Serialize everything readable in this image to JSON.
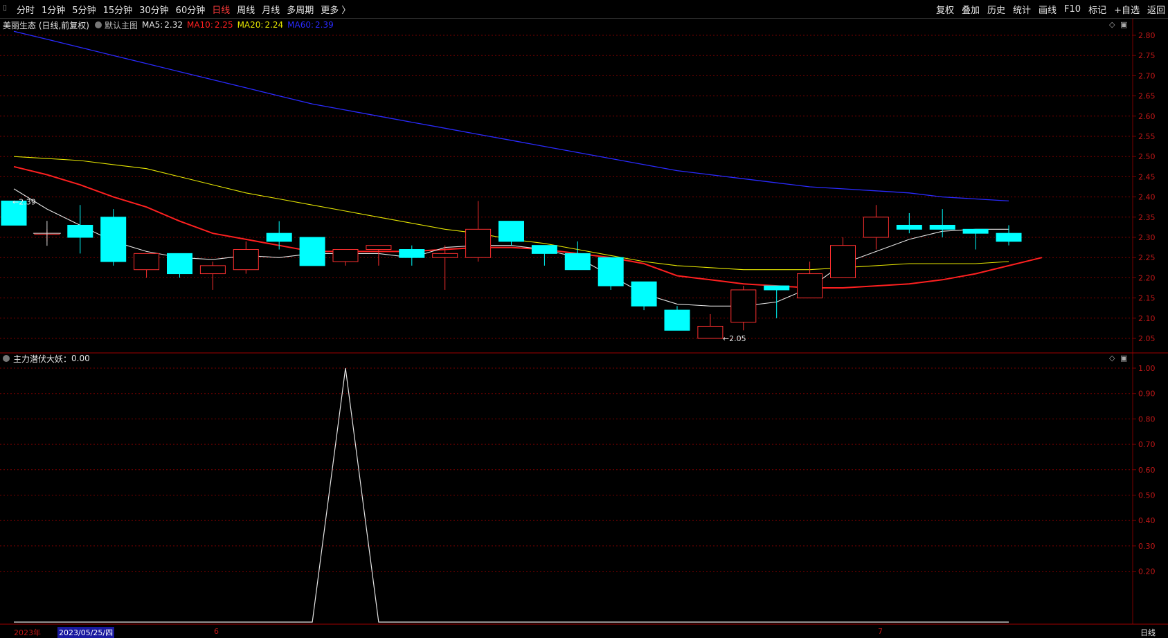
{
  "toolbar": {
    "periods": [
      "分时",
      "1分钟",
      "5分钟",
      "15分钟",
      "30分钟",
      "60分钟",
      "日线",
      "周线",
      "月线",
      "多周期",
      "更多 〉"
    ],
    "active_period": "日线",
    "tools": [
      "复权",
      "叠加",
      "历史",
      "统计",
      "画线",
      "F10",
      "标记",
      "+自选",
      "返回"
    ]
  },
  "main_legend": {
    "stock": "美丽生态 (日线,前复权)",
    "template": "默认主图",
    "ma": [
      {
        "label": "MA5:",
        "value": "2.32",
        "color": "#e6e6e6"
      },
      {
        "label": "MA10:",
        "value": "2.25",
        "color": "#ff2020"
      },
      {
        "label": "MA20:",
        "value": "2.24",
        "color": "#e6e600"
      },
      {
        "label": "MA60:",
        "value": "2.39",
        "color": "#2a2aff"
      }
    ]
  },
  "sub_legend": {
    "name": "主力潜伏大妖",
    "value": "0.00"
  },
  "annotations": {
    "high": "2.39",
    "low": "2.05"
  },
  "bottom": {
    "year": "2023年",
    "date": "2023/05/25/四",
    "m6": "6",
    "m7": "7",
    "period": "日线"
  },
  "colors": {
    "up": "#ff3030",
    "down": "#00ffff",
    "ma5": "#e6e6e6",
    "ma10": "#ff2020",
    "ma20": "#e6e600",
    "ma60": "#2a2aff",
    "grid": "#7a0000"
  },
  "chart_data": [
    {
      "type": "candlestick",
      "ylim": [
        2.05,
        2.8
      ],
      "yticks": [
        "2.80",
        "2.75",
        "2.70",
        "2.65",
        "2.60",
        "2.55",
        "2.50",
        "2.45",
        "2.40",
        "2.35",
        "2.30",
        "2.25",
        "2.20",
        "2.15",
        "2.10",
        "2.05"
      ],
      "candles": [
        {
          "o": 2.39,
          "h": 2.39,
          "l": 2.33,
          "c": 2.33
        },
        {
          "o": 2.31,
          "h": 2.32,
          "l": 2.29,
          "c": 2.31
        },
        {
          "o": 2.33,
          "h": 2.38,
          "l": 2.26,
          "c": 2.3
        },
        {
          "o": 2.35,
          "h": 2.37,
          "l": 2.23,
          "c": 2.24
        },
        {
          "o": 2.22,
          "h": 2.26,
          "l": 2.2,
          "c": 2.26
        },
        {
          "o": 2.26,
          "h": 2.26,
          "l": 2.2,
          "c": 2.21
        },
        {
          "o": 2.21,
          "h": 2.24,
          "l": 2.17,
          "c": 2.23
        },
        {
          "o": 2.22,
          "h": 2.29,
          "l": 2.21,
          "c": 2.27
        },
        {
          "o": 2.31,
          "h": 2.34,
          "l": 2.27,
          "c": 2.29
        },
        {
          "o": 2.3,
          "h": 2.3,
          "l": 2.23,
          "c": 2.23
        },
        {
          "o": 2.24,
          "h": 2.27,
          "l": 2.23,
          "c": 2.27
        },
        {
          "o": 2.27,
          "h": 2.28,
          "l": 2.23,
          "c": 2.28
        },
        {
          "o": 2.27,
          "h": 2.28,
          "l": 2.23,
          "c": 2.25
        },
        {
          "o": 2.25,
          "h": 2.28,
          "l": 2.17,
          "c": 2.26
        },
        {
          "o": 2.25,
          "h": 2.39,
          "l": 2.24,
          "c": 2.32
        },
        {
          "o": 2.34,
          "h": 2.34,
          "l": 2.28,
          "c": 2.29
        },
        {
          "o": 2.28,
          "h": 2.28,
          "l": 2.23,
          "c": 2.26
        },
        {
          "o": 2.26,
          "h": 2.29,
          "l": 2.22,
          "c": 2.22
        },
        {
          "o": 2.25,
          "h": 2.25,
          "l": 2.17,
          "c": 2.18
        },
        {
          "o": 2.19,
          "h": 2.19,
          "l": 2.12,
          "c": 2.13
        },
        {
          "o": 2.12,
          "h": 2.13,
          "l": 2.07,
          "c": 2.07
        },
        {
          "o": 2.05,
          "h": 2.11,
          "l": 2.05,
          "c": 2.08
        },
        {
          "o": 2.09,
          "h": 2.18,
          "l": 2.07,
          "c": 2.17
        },
        {
          "o": 2.18,
          "h": 2.18,
          "l": 2.1,
          "c": 2.17
        },
        {
          "o": 2.15,
          "h": 2.24,
          "l": 2.15,
          "c": 2.21
        },
        {
          "o": 2.2,
          "h": 2.3,
          "l": 2.2,
          "c": 2.28
        },
        {
          "o": 2.3,
          "h": 2.38,
          "l": 2.27,
          "c": 2.35
        },
        {
          "o": 2.33,
          "h": 2.36,
          "l": 2.31,
          "c": 2.32
        },
        {
          "o": 2.33,
          "h": 2.37,
          "l": 2.3,
          "c": 2.32
        },
        {
          "o": 2.32,
          "h": 2.32,
          "l": 2.27,
          "c": 2.31
        },
        {
          "o": 2.31,
          "h": 2.33,
          "l": 2.28,
          "c": 2.29
        }
      ],
      "ma5": [
        2.42,
        2.37,
        2.33,
        2.29,
        2.265,
        2.25,
        2.245,
        2.255,
        2.25,
        2.26,
        2.26,
        2.26,
        2.25,
        2.275,
        2.28,
        2.28,
        2.27,
        2.25,
        2.205,
        2.16,
        2.135,
        2.13,
        2.13,
        2.14,
        2.175,
        2.235,
        2.265,
        2.295,
        2.315,
        2.32,
        2.32
      ],
      "ma10": [
        2.475,
        2.455,
        2.43,
        2.4,
        2.375,
        2.34,
        2.31,
        2.295,
        2.28,
        2.265,
        2.265,
        2.265,
        2.265,
        2.27,
        2.275,
        2.275,
        2.27,
        2.26,
        2.25,
        2.235,
        2.205,
        2.195,
        2.185,
        2.18,
        2.175,
        2.175,
        2.18,
        2.185,
        2.195,
        2.21,
        2.23,
        2.25
      ],
      "ma20": [
        2.5,
        2.495,
        2.49,
        2.48,
        2.47,
        2.45,
        2.43,
        2.41,
        2.395,
        2.38,
        2.365,
        2.35,
        2.335,
        2.32,
        2.31,
        2.295,
        2.285,
        2.27,
        2.255,
        2.24,
        2.23,
        2.225,
        2.22,
        2.22,
        2.22,
        2.225,
        2.23,
        2.235,
        2.235,
        2.235,
        2.24
      ],
      "ma60": [
        2.81,
        2.79,
        2.77,
        2.75,
        2.73,
        2.71,
        2.69,
        2.67,
        2.65,
        2.63,
        2.615,
        2.6,
        2.585,
        2.57,
        2.555,
        2.54,
        2.525,
        2.51,
        2.495,
        2.48,
        2.465,
        2.455,
        2.445,
        2.435,
        2.425,
        2.42,
        2.415,
        2.41,
        2.4,
        2.395,
        2.39
      ]
    },
    {
      "type": "line",
      "title": "主力潜伏大妖",
      "ylim": [
        0,
        1.0
      ],
      "yticks": [
        "1.00",
        "0.90",
        "0.80",
        "0.70",
        "0.60",
        "0.50",
        "0.40",
        "0.30",
        "0.20"
      ],
      "values": [
        0,
        0,
        0,
        0,
        0,
        0,
        0,
        0,
        0,
        0,
        1,
        0,
        0,
        0,
        0,
        0,
        0,
        0,
        0,
        0,
        0,
        0,
        0,
        0,
        0,
        0,
        0,
        0,
        0,
        0,
        0
      ]
    }
  ]
}
